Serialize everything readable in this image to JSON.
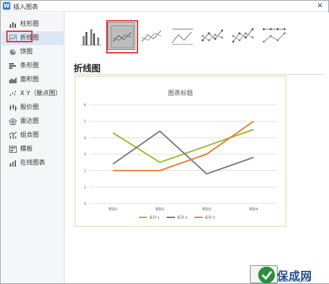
{
  "window": {
    "title": "插入图表",
    "app_icon_letter": "W",
    "close_glyph": "×"
  },
  "sidebar": {
    "items": [
      {
        "label": "柱形图",
        "icon": "column-chart-icon"
      },
      {
        "label": "折线图",
        "icon": "line-chart-icon",
        "selected": true
      },
      {
        "label": "饼图",
        "icon": "pie-chart-icon"
      },
      {
        "label": "条形图",
        "icon": "bar-chart-icon"
      },
      {
        "label": "面积图",
        "icon": "area-chart-icon"
      },
      {
        "label": "X Y（散点图）",
        "icon": "scatter-chart-icon"
      },
      {
        "label": "股价图",
        "icon": "stock-chart-icon"
      },
      {
        "label": "雷达图",
        "icon": "radar-chart-icon"
      },
      {
        "label": "组合图",
        "icon": "combo-chart-icon"
      },
      {
        "label": "模板",
        "icon": "template-icon"
      },
      {
        "label": "在线图表",
        "icon": "online-chart-icon"
      }
    ]
  },
  "main": {
    "section_title": "折线图"
  },
  "chart_data": {
    "type": "line",
    "title": "图表标题",
    "categories": [
      "类别1",
      "类别2",
      "类别3",
      "类别4"
    ],
    "series": [
      {
        "name": "系列 1",
        "values": [
          4.3,
          2.5,
          3.5,
          4.5
        ],
        "color": "#9bbb2a"
      },
      {
        "name": "系列 2",
        "values": [
          2.4,
          4.4,
          1.8,
          2.8
        ],
        "color": "#7a7a7a"
      },
      {
        "name": "系列 3",
        "values": [
          2.0,
          2.0,
          3.0,
          5.0
        ],
        "color": "#ed7d31"
      }
    ],
    "ylim": [
      0,
      6
    ],
    "yticks": [
      0,
      1,
      2,
      3,
      4,
      5,
      6
    ],
    "grid": true,
    "legend": "bottom"
  },
  "watermark": {
    "text": "保成网",
    "url": "zsbaocheng.net"
  },
  "colors": {
    "selection_red": "#e23a3a",
    "accent_blue": "#2f7fd8"
  }
}
